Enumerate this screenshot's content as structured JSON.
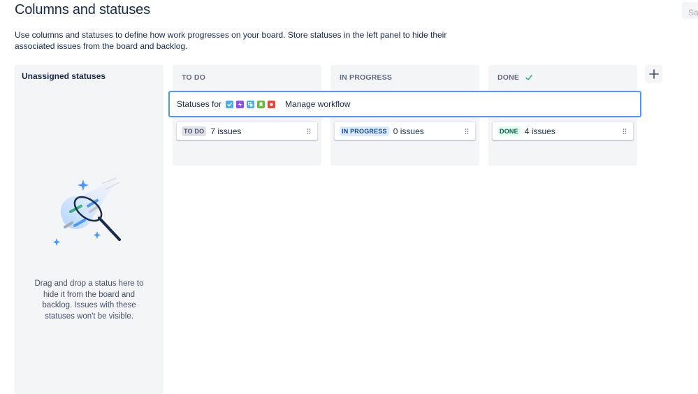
{
  "header": {
    "title": "Columns and statuses",
    "save_label": "Sa",
    "description": "Use columns and statuses to define how work progresses on your board. Store statuses in the left panel to hide their associated issues from the board and backlog."
  },
  "unassigned": {
    "title": "Unassigned statuses",
    "hint": "Drag and drop a status here to hide it from the board and backlog. Issues with these statuses won't be visible."
  },
  "columns": [
    {
      "name": "TO DO",
      "status": "TO DO",
      "count": "7 issues"
    },
    {
      "name": "IN PROGRESS",
      "status": "IN PROGRESS",
      "count": "0 issues"
    },
    {
      "name": "DONE",
      "status": "DONE",
      "count": "4 issues",
      "icon": "check-icon"
    }
  ],
  "statuses_bar": {
    "label": "Statuses for",
    "issue_types": [
      {
        "icon": "task-icon",
        "color": "#4bade8"
      },
      {
        "icon": "epic-icon",
        "color": "#904ee2"
      },
      {
        "icon": "subtask-icon",
        "color": "#4bade8"
      },
      {
        "icon": "story-icon",
        "color": "#63ba3c"
      },
      {
        "icon": "bug-icon",
        "color": "#e5493a"
      }
    ],
    "manage_label": "Manage workflow"
  },
  "colors": {
    "accent": "#4c9aff",
    "done_check": "#36b37e",
    "panel": "#f4f5f7"
  }
}
